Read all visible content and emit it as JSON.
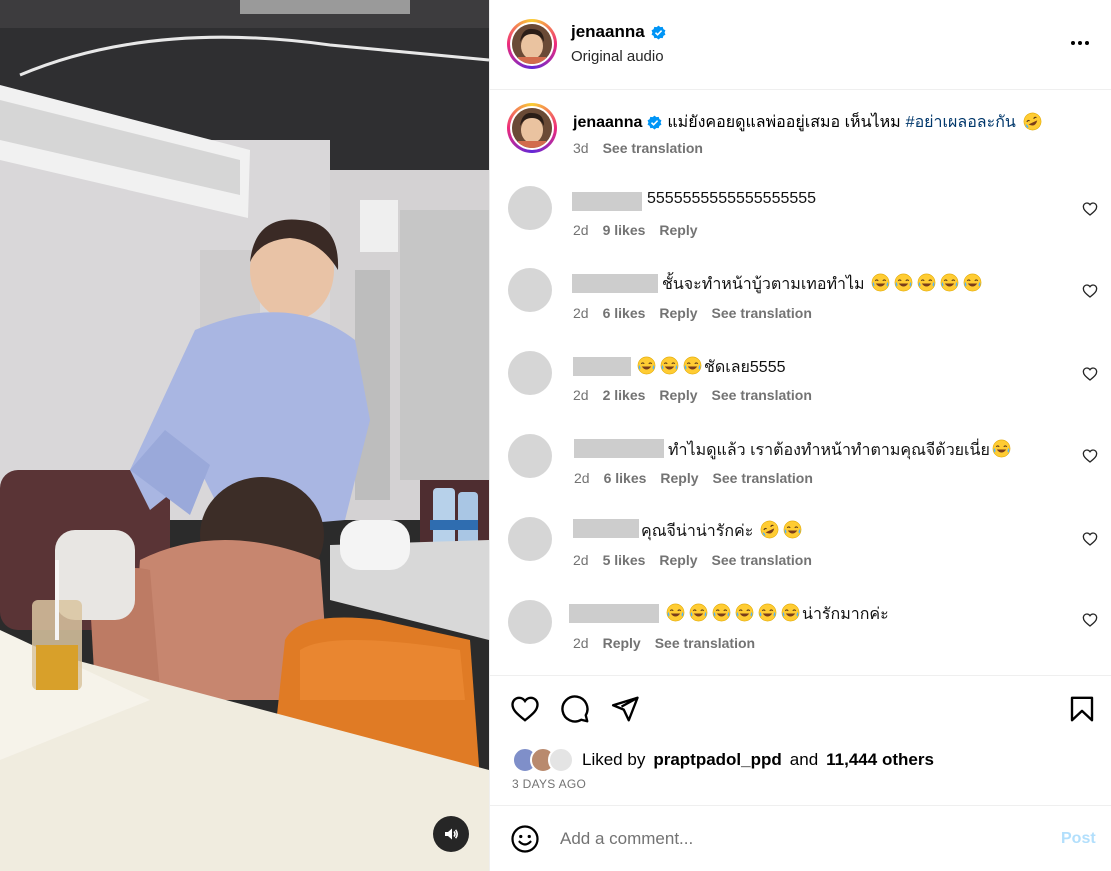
{
  "post": {
    "username": "jenaanna",
    "audio": "Original audio",
    "verified": true
  },
  "caption": {
    "username": "jenaanna",
    "text": "แม่ยังคอยดูแลพ่ออยู่เสมอ เห็นไหม",
    "hashtag": "#อย่าเผลอละกัน",
    "emoji": "rolling-on-floor-laughing",
    "age": "3d",
    "translate_label": "See translation"
  },
  "comments": [
    {
      "text": "5555555555555555555",
      "age": "2d",
      "likes": "9 likes",
      "reply": "Reply",
      "translate": ""
    },
    {
      "text": "ชั้นจะทำหน้าบู้วตามเทอทำไม",
      "emoji_after": [
        "joy",
        "joy",
        "joy",
        "joy",
        "joy"
      ],
      "age": "2d",
      "likes": "6 likes",
      "reply": "Reply",
      "translate": "See translation"
    },
    {
      "emoji_before": [
        "joy",
        "joy",
        "joy"
      ],
      "text": "ชัดเลย5555",
      "age": "2d",
      "likes": "2 likes",
      "reply": "Reply",
      "translate": "See translation"
    },
    {
      "text": "ทำไมดูแล้ว เราต้องทำหน้าทำตามคุณจีด้วยเนี่ย",
      "emoji_after": [
        "joy"
      ],
      "age": "2d",
      "likes": "6 likes",
      "reply": "Reply",
      "translate": "See translation"
    },
    {
      "text": "คุณจีน่าน่ารักค่ะ",
      "emoji_after": [
        "rofl",
        "joy"
      ],
      "age": "2d",
      "likes": "5 likes",
      "reply": "Reply",
      "translate": "See translation"
    },
    {
      "emoji_before": [
        "joy",
        "joy",
        "joy",
        "joy",
        "joy",
        "joy"
      ],
      "text": "น่ารักมากค่ะ",
      "age": "2d",
      "likes": "",
      "reply": "Reply",
      "translate": "See translation"
    }
  ],
  "actions": {
    "liked_prefix": "Liked by",
    "liked_user": "praptpadol_ppd",
    "liked_and": "and",
    "liked_others": "11,444 others",
    "time_ago": "3 DAYS AGO"
  },
  "composer": {
    "placeholder": "Add a comment...",
    "post_label": "Post"
  },
  "icons": [
    "verified-icon",
    "more-icon",
    "heart-icon",
    "comment-icon",
    "share-icon",
    "bookmark-icon",
    "emoji-icon",
    "volume-icon"
  ],
  "colors": {
    "link_blue": "#00376b",
    "verified_blue": "#0095f6",
    "post_disabled": "#b2dffc",
    "secondary_text": "#737373"
  }
}
